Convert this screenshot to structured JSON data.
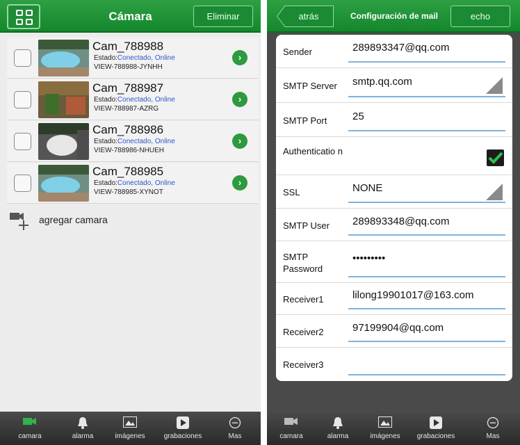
{
  "left": {
    "header": {
      "title": "Cámara",
      "delete_label": "Eliminar"
    },
    "cameras": [
      {
        "name": "Cam_788988",
        "state_label": "Estado:",
        "state_value": "Conectado, Online",
        "view_id": "VIEW-788988-JYNHH",
        "thumb": "pool"
      },
      {
        "name": "Cam_788987",
        "state_label": "Estado:",
        "state_value": "Conectado, Online",
        "view_id": "VIEW-788987-AZRG",
        "thumb": "garden"
      },
      {
        "name": "Cam_788986",
        "state_label": "Estado:",
        "state_value": "Conectado, Online",
        "view_id": "VIEW-788986-NHUEH",
        "thumb": "car"
      },
      {
        "name": "Cam_788985",
        "state_label": "Estado:",
        "state_value": "Conectado, Online",
        "view_id": "VIEW-788985-XYNOT",
        "thumb": "pool"
      }
    ],
    "add_camera_label": "agregar camara"
  },
  "right": {
    "header": {
      "back_label": "atrás",
      "title": "Configuración de mail",
      "done_label": "echo"
    },
    "fields": [
      {
        "label": "Sender",
        "value": "289893347@qq.com",
        "kind": "text"
      },
      {
        "label": "SMTP Server",
        "value": "smtp.qq.com",
        "kind": "select"
      },
      {
        "label": "SMTP Port",
        "value": "25",
        "kind": "text"
      },
      {
        "label": "Authenticatio n",
        "value": "",
        "kind": "checkbox",
        "checked": true
      },
      {
        "label": "SSL",
        "value": "NONE",
        "kind": "select"
      },
      {
        "label": "SMTP User",
        "value": "289893348@qq.com",
        "kind": "text"
      },
      {
        "label": "SMTP Password",
        "value": "•••••••••",
        "kind": "password"
      },
      {
        "label": "Receiver1",
        "value": "lilong19901017@163.com",
        "kind": "text"
      },
      {
        "label": "Receiver2",
        "value": "97199904@qq.com",
        "kind": "text"
      },
      {
        "label": "Receiver3",
        "value": "",
        "kind": "text"
      }
    ]
  },
  "nav": [
    {
      "label": "camara",
      "icon": "camera-icon"
    },
    {
      "label": "alarma",
      "icon": "bell-icon"
    },
    {
      "label": "imágenes",
      "icon": "image-icon"
    },
    {
      "label": "grabaciones",
      "icon": "play-icon"
    },
    {
      "label": "Mas",
      "icon": "more-icon"
    }
  ],
  "colors": {
    "accent_green": "#17892f",
    "nav_bg": "#3a3a3a",
    "active_tab": "#2fb34a",
    "link_blue": "#2d58c8"
  }
}
